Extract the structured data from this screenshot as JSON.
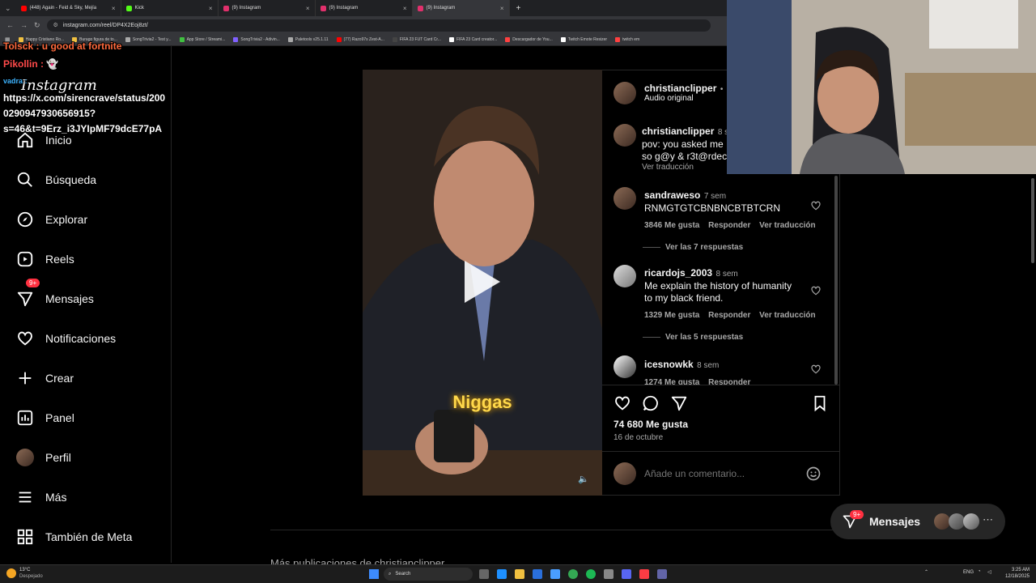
{
  "browser": {
    "tabs": [
      {
        "label": "(448) Again - Feid & Sky, Mejía",
        "color": "#ff0000"
      },
      {
        "label": "Kick",
        "color": "#53fc18"
      },
      {
        "label": "(9) Instagram",
        "color": "#e1306c"
      },
      {
        "label": "(9) Instagram",
        "color": "#e1306c"
      },
      {
        "label": "(9) Instagram",
        "color": "#e1306c"
      }
    ],
    "new_tab": "+",
    "url": "instagram.com/reel/DP4X2Eoj8zt/",
    "bookmarks": [
      {
        "label": "Happy Cristiano Ro...",
        "color": "#f0c040"
      },
      {
        "label": "Burago figura de to...",
        "color": "#f0c040"
      },
      {
        "label": "SongTrivia2 - Test y...",
        "color": "#aaaaaa"
      },
      {
        "label": "App Store / Streami...",
        "color": "#40c040"
      },
      {
        "label": "SongTrivia2 - Adivin...",
        "color": "#8060ff"
      },
      {
        "label": "Paletools v25.1.11",
        "color": "#aaaaaa"
      },
      {
        "label": "(77) Razo97s Zest-A...",
        "color": "#ff0000"
      },
      {
        "label": "FIFA 23 FUT Card Cr...",
        "color": "#444444"
      },
      {
        "label": "FIFA 23 Card creator...",
        "color": "#ffffff"
      },
      {
        "label": "Descargador de You...",
        "color": "#ff4040"
      },
      {
        "label": "Twitch Emote Resizer",
        "color": "#ffffff"
      },
      {
        "label": "twitch em",
        "color": "#ff4040"
      }
    ]
  },
  "chat": {
    "line1": "Tolsck : u good at fortnite",
    "line2": "Pikollin :",
    "line3_user": "vadra :",
    "line3_a": "https://x.com/sirencrave/status/200",
    "line3_b": "0290947930656915?",
    "line3_c": "s=46&t=9Erz_i3JYIpMF79dcE77pA"
  },
  "sidebar": {
    "logo": "Instagram",
    "items": [
      {
        "label": "Inicio",
        "icon": "home-icon"
      },
      {
        "label": "Búsqueda",
        "icon": "search-icon"
      },
      {
        "label": "Explorar",
        "icon": "compass-icon"
      },
      {
        "label": "Reels",
        "icon": "reels-icon"
      },
      {
        "label": "Mensajes",
        "icon": "messenger-icon",
        "badge": "9+"
      },
      {
        "label": "Notificaciones",
        "icon": "heart-icon"
      },
      {
        "label": "Crear",
        "icon": "plus-icon"
      },
      {
        "label": "Panel",
        "icon": "chart-icon"
      },
      {
        "label": "Perfil",
        "icon": "avatar-icon"
      },
      {
        "label": "Más",
        "icon": "menu-icon"
      },
      {
        "label": "También de Meta",
        "icon": "meta-icon"
      }
    ]
  },
  "post": {
    "caption_overlay": "Niggas",
    "author": "christianclipper",
    "follow_dot": "•",
    "follow": "S",
    "audio": "Audio original",
    "caption": {
      "user": "christianclipper",
      "time": "8 s",
      "text1": "pov: you asked me",
      "text2": "so g@y & r3t@rdec",
      "translate": "Ver traducción"
    },
    "comments": [
      {
        "user": "sandraweso",
        "time": "7 sem",
        "text1": "RNMGTGTCBNBNCBTBTCRN",
        "text2": "",
        "likes": "3846 Me gusta",
        "reply": "Responder",
        "translate": "Ver traducción",
        "replies": "Ver las 7 respuestas"
      },
      {
        "user": "ricardojs_2003",
        "time": "8 sem",
        "text1": "Me explain the history of humanity",
        "text2": "to my black friend.",
        "likes": "1329 Me gusta",
        "reply": "Responder",
        "translate": "Ver traducción",
        "replies": "Ver las 5 respuestas"
      },
      {
        "user": "icesnowkk",
        "time": "8 sem",
        "text1": "",
        "text2": "",
        "likes": "1274 Me gusta",
        "reply": "Responder",
        "translate": "",
        "replies": ""
      }
    ],
    "likes": "74 680 Me gusta",
    "date": "16 de octubre",
    "comment_placeholder": "Añade un comentario..."
  },
  "messages_pill": {
    "label": "Mensajes",
    "badge": "9+"
  },
  "more_below": "Más publicaciones de christianclipper",
  "taskbar": {
    "weather_temp": "13°C",
    "weather_desc": "Despejado",
    "search": "Search",
    "lang": "ENG",
    "time": "3:25 AM",
    "date": "12/18/2025"
  }
}
